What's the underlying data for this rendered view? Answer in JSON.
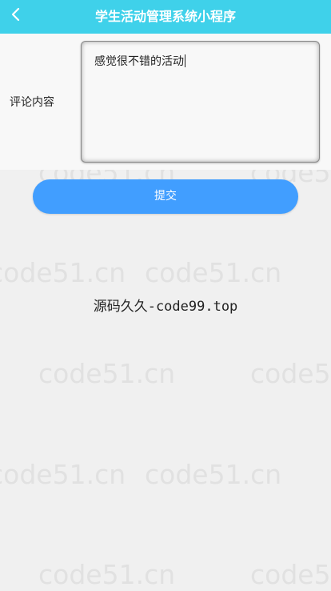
{
  "header": {
    "back_icon": "chevron-left-icon",
    "title": "学生活动管理系统小程序",
    "background": "#3fd1ea"
  },
  "form": {
    "comment_label": "评论内容",
    "comment_value": "感觉很不错的活动",
    "submit_label": "提交",
    "submit_color": "#419eff"
  },
  "footer": {
    "text": "源码久久-code99.top"
  },
  "watermark": {
    "text": "code51.cn"
  }
}
